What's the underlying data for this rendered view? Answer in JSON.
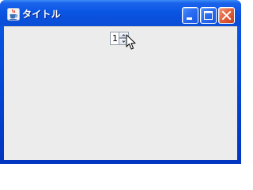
{
  "window": {
    "title": "タイトル",
    "icon": "java-cup-icon",
    "controls": {
      "minimize_icon": "minimize-icon",
      "maximize_icon": "maximize-icon",
      "close_icon": "close-icon"
    }
  },
  "spinner": {
    "value": "1",
    "up_icon": "spinner-up-arrow-icon",
    "down_icon": "spinner-down-arrow-icon"
  },
  "cursor": {
    "icon": "mouse-pointer-icon"
  },
  "colors": {
    "titlebar": "#0a56e4",
    "client_background": "#ececec",
    "close_button": "#e2643f"
  }
}
